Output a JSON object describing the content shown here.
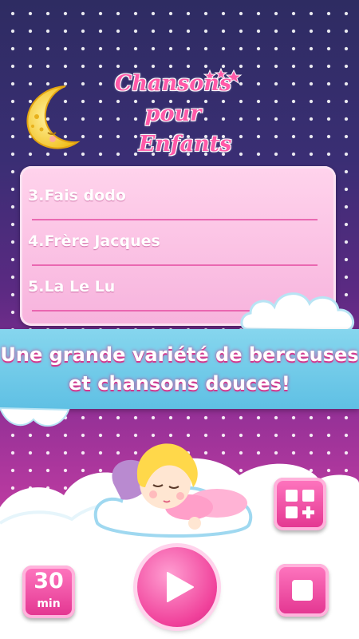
{
  "app": {
    "title_line1": "Chansons pour",
    "title_line2": "Enfants"
  },
  "playlist": {
    "items": [
      {
        "label": "3.Fais dodo"
      },
      {
        "label": "4.Frère Jacques"
      },
      {
        "label": "5.La Le Lu"
      }
    ]
  },
  "banner": {
    "line1": "Une grande variété de berceuses",
    "line2": "et chansons douces!"
  },
  "timer": {
    "value": "30",
    "unit": "min"
  },
  "icons": {
    "moon": "crescent-moon-icon",
    "add_playlist": "grid-plus-icon",
    "play": "play-icon",
    "stop": "stop-icon"
  },
  "colors": {
    "accent_pink": "#e2338f",
    "banner_blue": "#6fcbe9",
    "title_pink": "#ff5aa8"
  }
}
